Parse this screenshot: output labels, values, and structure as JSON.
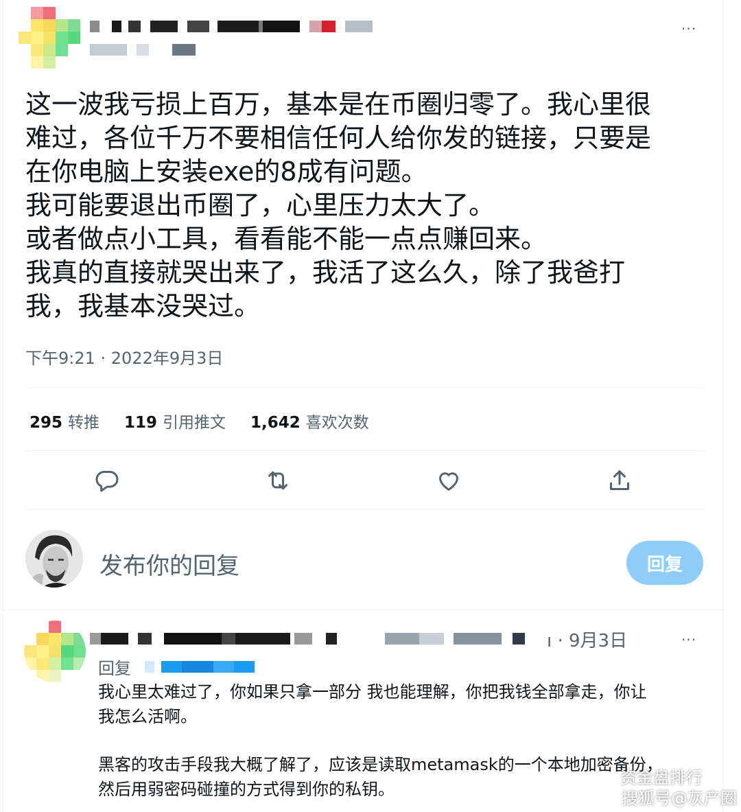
{
  "tweet": {
    "lines": [
      "这一波我亏损上百万，基本是在币圈归零了。我心里很",
      "难过，各位千万不要相信任何人给你发的链接，只要是",
      "在你电脑上安装exe的8成有问题。",
      "我可能要退出币圈了，心里压力太大了。",
      "或者做点小工具，看看能不能一点点赚回来。",
      "我真的直接就哭出来了，我活了这么久，除了我爸打",
      "我，我基本没哭过。"
    ],
    "timestamp": "下午9:21 · 2022年9月3日",
    "more": "···"
  },
  "stats": {
    "retweets_count": "295",
    "retweets_label": "转推",
    "quotes_count": "119",
    "quotes_label": "引用推文",
    "likes_count": "1,642",
    "likes_label": "喜欢次数"
  },
  "reply_box": {
    "placeholder": "发布你的回复",
    "button": "回复"
  },
  "reply": {
    "meta": "ı · 9月3日",
    "replying_to": "回复",
    "more": "···",
    "lines": [
      "我心里太难过了，你如果只拿一部分 我也能理解，你把我钱全部拿走，你让",
      "我怎么活啊。",
      "",
      "黑客的攻击手段我大概了解了，应该是读取metamask的一个本地加密备份，",
      "然后用弱密码碰撞的方式得到你的私钥。"
    ]
  },
  "watermark": {
    "line1": "资金盘排行",
    "line2": "搜狐号@灰产圈"
  },
  "colors": {
    "text": "#0f1419",
    "secondary": "#536471",
    "border": "#eff3f4",
    "reply_button": "#8ecdf8",
    "link": "#1d9bf0"
  },
  "icons": [
    "more-icon",
    "reply-icon",
    "retweet-icon",
    "like-icon",
    "share-icon"
  ]
}
